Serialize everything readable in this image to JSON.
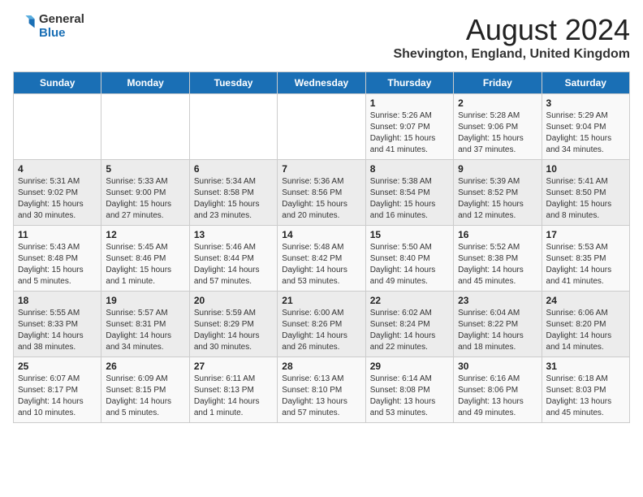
{
  "header": {
    "logo_general": "General",
    "logo_blue": "Blue",
    "month_title": "August 2024",
    "location": "Shevington, England, United Kingdom"
  },
  "days_of_week": [
    "Sunday",
    "Monday",
    "Tuesday",
    "Wednesday",
    "Thursday",
    "Friday",
    "Saturday"
  ],
  "weeks": [
    [
      {
        "num": "",
        "content": ""
      },
      {
        "num": "",
        "content": ""
      },
      {
        "num": "",
        "content": ""
      },
      {
        "num": "",
        "content": ""
      },
      {
        "num": "1",
        "content": "Sunrise: 5:26 AM\nSunset: 9:07 PM\nDaylight: 15 hours\nand 41 minutes."
      },
      {
        "num": "2",
        "content": "Sunrise: 5:28 AM\nSunset: 9:06 PM\nDaylight: 15 hours\nand 37 minutes."
      },
      {
        "num": "3",
        "content": "Sunrise: 5:29 AM\nSunset: 9:04 PM\nDaylight: 15 hours\nand 34 minutes."
      }
    ],
    [
      {
        "num": "4",
        "content": "Sunrise: 5:31 AM\nSunset: 9:02 PM\nDaylight: 15 hours\nand 30 minutes."
      },
      {
        "num": "5",
        "content": "Sunrise: 5:33 AM\nSunset: 9:00 PM\nDaylight: 15 hours\nand 27 minutes."
      },
      {
        "num": "6",
        "content": "Sunrise: 5:34 AM\nSunset: 8:58 PM\nDaylight: 15 hours\nand 23 minutes."
      },
      {
        "num": "7",
        "content": "Sunrise: 5:36 AM\nSunset: 8:56 PM\nDaylight: 15 hours\nand 20 minutes."
      },
      {
        "num": "8",
        "content": "Sunrise: 5:38 AM\nSunset: 8:54 PM\nDaylight: 15 hours\nand 16 minutes."
      },
      {
        "num": "9",
        "content": "Sunrise: 5:39 AM\nSunset: 8:52 PM\nDaylight: 15 hours\nand 12 minutes."
      },
      {
        "num": "10",
        "content": "Sunrise: 5:41 AM\nSunset: 8:50 PM\nDaylight: 15 hours\nand 8 minutes."
      }
    ],
    [
      {
        "num": "11",
        "content": "Sunrise: 5:43 AM\nSunset: 8:48 PM\nDaylight: 15 hours\nand 5 minutes."
      },
      {
        "num": "12",
        "content": "Sunrise: 5:45 AM\nSunset: 8:46 PM\nDaylight: 15 hours\nand 1 minute."
      },
      {
        "num": "13",
        "content": "Sunrise: 5:46 AM\nSunset: 8:44 PM\nDaylight: 14 hours\nand 57 minutes."
      },
      {
        "num": "14",
        "content": "Sunrise: 5:48 AM\nSunset: 8:42 PM\nDaylight: 14 hours\nand 53 minutes."
      },
      {
        "num": "15",
        "content": "Sunrise: 5:50 AM\nSunset: 8:40 PM\nDaylight: 14 hours\nand 49 minutes."
      },
      {
        "num": "16",
        "content": "Sunrise: 5:52 AM\nSunset: 8:38 PM\nDaylight: 14 hours\nand 45 minutes."
      },
      {
        "num": "17",
        "content": "Sunrise: 5:53 AM\nSunset: 8:35 PM\nDaylight: 14 hours\nand 41 minutes."
      }
    ],
    [
      {
        "num": "18",
        "content": "Sunrise: 5:55 AM\nSunset: 8:33 PM\nDaylight: 14 hours\nand 38 minutes."
      },
      {
        "num": "19",
        "content": "Sunrise: 5:57 AM\nSunset: 8:31 PM\nDaylight: 14 hours\nand 34 minutes."
      },
      {
        "num": "20",
        "content": "Sunrise: 5:59 AM\nSunset: 8:29 PM\nDaylight: 14 hours\nand 30 minutes."
      },
      {
        "num": "21",
        "content": "Sunrise: 6:00 AM\nSunset: 8:26 PM\nDaylight: 14 hours\nand 26 minutes."
      },
      {
        "num": "22",
        "content": "Sunrise: 6:02 AM\nSunset: 8:24 PM\nDaylight: 14 hours\nand 22 minutes."
      },
      {
        "num": "23",
        "content": "Sunrise: 6:04 AM\nSunset: 8:22 PM\nDaylight: 14 hours\nand 18 minutes."
      },
      {
        "num": "24",
        "content": "Sunrise: 6:06 AM\nSunset: 8:20 PM\nDaylight: 14 hours\nand 14 minutes."
      }
    ],
    [
      {
        "num": "25",
        "content": "Sunrise: 6:07 AM\nSunset: 8:17 PM\nDaylight: 14 hours\nand 10 minutes."
      },
      {
        "num": "26",
        "content": "Sunrise: 6:09 AM\nSunset: 8:15 PM\nDaylight: 14 hours\nand 5 minutes."
      },
      {
        "num": "27",
        "content": "Sunrise: 6:11 AM\nSunset: 8:13 PM\nDaylight: 14 hours\nand 1 minute."
      },
      {
        "num": "28",
        "content": "Sunrise: 6:13 AM\nSunset: 8:10 PM\nDaylight: 13 hours\nand 57 minutes."
      },
      {
        "num": "29",
        "content": "Sunrise: 6:14 AM\nSunset: 8:08 PM\nDaylight: 13 hours\nand 53 minutes."
      },
      {
        "num": "30",
        "content": "Sunrise: 6:16 AM\nSunset: 8:06 PM\nDaylight: 13 hours\nand 49 minutes."
      },
      {
        "num": "31",
        "content": "Sunrise: 6:18 AM\nSunset: 8:03 PM\nDaylight: 13 hours\nand 45 minutes."
      }
    ]
  ]
}
